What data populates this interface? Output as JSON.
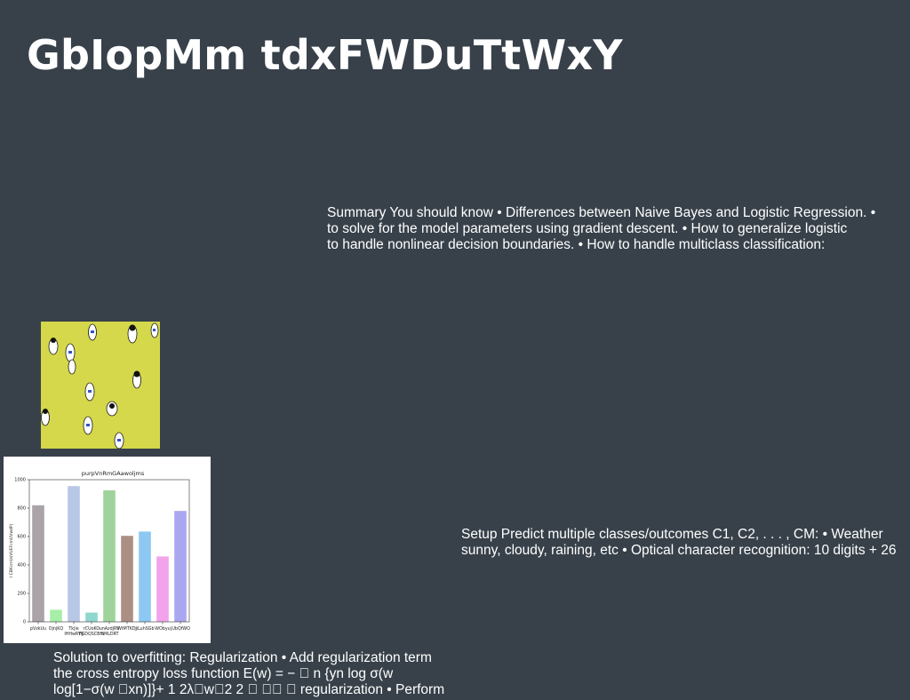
{
  "slide": {
    "title": "GbIopMm tdxFWDuTtWxY",
    "summary_lines": [
      "Summary You should know • Differences between Naive Bayes and Logistic Regression. •",
      "to solve for the model parameters using gradient descent. • How to generalize logistic",
      "to handle nonlinear decision boundaries. • How to handle multiclass classification:"
    ],
    "setup_lines": [
      "Setup Predict multiple classes/outcomes C1, C2, . . . , CM: • Weather",
      "sunny, cloudy, raining, etc • Optical character recognition: 10 digits + 26"
    ],
    "solution_lines": [
      "Solution to overfitting: Regularization • Add regularization term",
      "the cross entropy loss function E(w) = − \u0000 n {yn log σ(w",
      "log[1−σ(w \u0000xn)]}+ 1 2λ\u0000w\u00002 2 \u0000 \u0000\u0000 \u0000 regularization • Perform"
    ],
    "colors": {
      "background": "#38414a",
      "text": "#ffffff",
      "photo_background": "#d4d84a"
    }
  },
  "chart_data": {
    "type": "bar",
    "title": "purpVnRmGAawoljms",
    "xlabel": "",
    "ylabel": "I CBKcmUsVUEFcmUVwdP|",
    "ylim": [
      0,
      1000
    ],
    "yticks": [
      0,
      200,
      400,
      600,
      800,
      1000
    ],
    "categories": [
      "pVzkUu",
      "OjnjKQ",
      "Tkjle\nIHHwRYIJ",
      "rCUoKO\nFGDQSCBfS",
      "unAzdjRV\nmMLDRT",
      "WtMTKDj",
      "jiLuhSGb",
      "WObyu",
      "jUbQfWO"
    ],
    "values": [
      820,
      85,
      955,
      65,
      925,
      605,
      635,
      460,
      780
    ],
    "colors": [
      "#aaa3a7",
      "#a7eea8",
      "#b8c7e6",
      "#8fd6cf",
      "#9fd39b",
      "#ab8f85",
      "#8cc8f1",
      "#f2a3ea",
      "#a9a7ef"
    ]
  }
}
